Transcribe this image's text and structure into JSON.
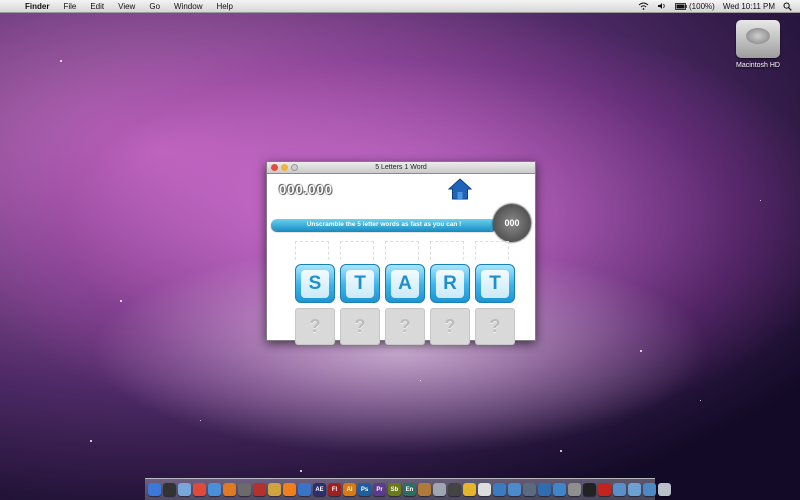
{
  "menubar": {
    "apple_glyph": "",
    "app": "Finder",
    "menus": [
      "File",
      "Edit",
      "View",
      "Go",
      "Window",
      "Help"
    ],
    "battery": "(100%)",
    "clock": "Wed 10:11 PM"
  },
  "desktop": {
    "drive_label": "Macintosh HD"
  },
  "window": {
    "title": "5 Letters 1 Word",
    "score": "000.000",
    "instruction": "Unscramble the 5 letter words as fast as you can !",
    "timer": "000",
    "letters": [
      "S",
      "T",
      "A",
      "R",
      "T"
    ],
    "slots": [
      "?",
      "?",
      "?",
      "?",
      "?"
    ]
  },
  "dock": {
    "icons": [
      {
        "name": "finder-icon",
        "label": "",
        "color": "#3b78d8"
      },
      {
        "name": "dashboard-icon",
        "label": "",
        "color": "#333333"
      },
      {
        "name": "mail-icon",
        "label": "",
        "color": "#7aa7d9"
      },
      {
        "name": "calendar-icon",
        "label": "",
        "color": "#e04a3a"
      },
      {
        "name": "safari-icon",
        "label": "",
        "color": "#4a90d9"
      },
      {
        "name": "firefox-icon",
        "label": "",
        "color": "#e07a22"
      },
      {
        "name": "network-icon",
        "label": "",
        "color": "#6b6b6b"
      },
      {
        "name": "addressbook-icon",
        "label": "",
        "color": "#b5312d"
      },
      {
        "name": "pencil-icon",
        "label": "",
        "color": "#d1a33f"
      },
      {
        "name": "vlc-icon",
        "label": "",
        "color": "#f07f1c"
      },
      {
        "name": "itunes-icon",
        "label": "",
        "color": "#3a73c8"
      },
      {
        "name": "after-effects-icon",
        "label": "AE",
        "color": "#2b2f6b"
      },
      {
        "name": "flash-icon",
        "label": "Fl",
        "color": "#a02020"
      },
      {
        "name": "illustrator-icon",
        "label": "Ai",
        "color": "#d87a10"
      },
      {
        "name": "photoshop-icon",
        "label": "Ps",
        "color": "#1f5d9c"
      },
      {
        "name": "premiere-icon",
        "label": "Pr",
        "color": "#5b3b8c"
      },
      {
        "name": "soundbooth-icon",
        "label": "Sb",
        "color": "#6a7a1a"
      },
      {
        "name": "encore-icon",
        "label": "En",
        "color": "#2c6f5e"
      },
      {
        "name": "brush-icon",
        "label": "",
        "color": "#b07b3a"
      },
      {
        "name": "cd-icon",
        "label": "",
        "color": "#9ea6b1"
      },
      {
        "name": "dvd-icon",
        "label": "",
        "color": "#444444"
      },
      {
        "name": "photo-icon",
        "label": "",
        "color": "#e6b52a"
      },
      {
        "name": "ipod-icon",
        "label": "",
        "color": "#dddddd"
      },
      {
        "name": "xcode-icon",
        "label": "",
        "color": "#3b7bbf"
      },
      {
        "name": "network-utility-icon",
        "label": "",
        "color": "#4b8bc9"
      },
      {
        "name": "preview-icon",
        "label": "",
        "color": "#5a6b80"
      },
      {
        "name": "quicktime-icon",
        "label": "",
        "color": "#2f6db0"
      },
      {
        "name": "folder-icon",
        "label": "",
        "color": "#3f85c9"
      },
      {
        "name": "preferences-icon",
        "label": "",
        "color": "#8f8f8f"
      },
      {
        "name": "terminal-icon",
        "label": "",
        "color": "#222222"
      },
      {
        "name": "flash-player-icon",
        "label": "",
        "color": "#c2241f"
      },
      {
        "name": "app-folder-icon",
        "label": "",
        "color": "#5a8fc8"
      },
      {
        "name": "documents-folder-icon",
        "label": "",
        "color": "#6da0d3"
      },
      {
        "name": "downloads-folder-icon",
        "label": "",
        "color": "#4e88c4"
      },
      {
        "name": "trash-icon",
        "label": "",
        "color": "#b9c0c8"
      }
    ]
  }
}
